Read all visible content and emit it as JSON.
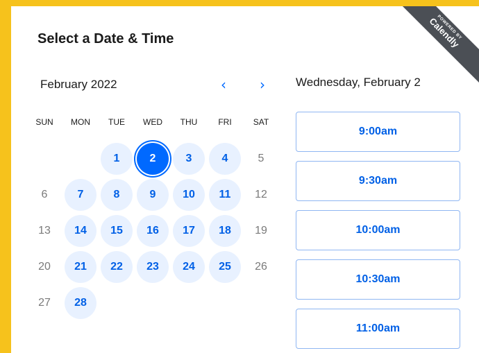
{
  "title": "Select a Date & Time",
  "powered_by": {
    "line1": "POWERED BY",
    "brand": "Calendly"
  },
  "calendar": {
    "month": "February 2022",
    "prev": "‹",
    "next": "›",
    "weekdays": [
      "SUN",
      "MON",
      "TUE",
      "WED",
      "THU",
      "FRI",
      "SAT"
    ],
    "days": [
      {
        "label": "",
        "state": "empty"
      },
      {
        "label": "",
        "state": "empty"
      },
      {
        "label": "1",
        "state": "available"
      },
      {
        "label": "2",
        "state": "selected"
      },
      {
        "label": "3",
        "state": "available"
      },
      {
        "label": "4",
        "state": "available"
      },
      {
        "label": "5",
        "state": "unavailable"
      },
      {
        "label": "6",
        "state": "unavailable"
      },
      {
        "label": "7",
        "state": "available"
      },
      {
        "label": "8",
        "state": "available"
      },
      {
        "label": "9",
        "state": "available"
      },
      {
        "label": "10",
        "state": "available"
      },
      {
        "label": "11",
        "state": "available"
      },
      {
        "label": "12",
        "state": "unavailable"
      },
      {
        "label": "13",
        "state": "unavailable"
      },
      {
        "label": "14",
        "state": "available"
      },
      {
        "label": "15",
        "state": "available"
      },
      {
        "label": "16",
        "state": "available"
      },
      {
        "label": "17",
        "state": "available"
      },
      {
        "label": "18",
        "state": "available"
      },
      {
        "label": "19",
        "state": "unavailable"
      },
      {
        "label": "20",
        "state": "unavailable"
      },
      {
        "label": "21",
        "state": "available"
      },
      {
        "label": "22",
        "state": "available"
      },
      {
        "label": "23",
        "state": "available"
      },
      {
        "label": "24",
        "state": "available"
      },
      {
        "label": "25",
        "state": "available"
      },
      {
        "label": "26",
        "state": "unavailable"
      },
      {
        "label": "27",
        "state": "unavailable"
      },
      {
        "label": "28",
        "state": "available"
      }
    ]
  },
  "selected_date": "Wednesday, February 2",
  "time_slots": [
    "9:00am",
    "9:30am",
    "10:00am",
    "10:30am",
    "11:00am"
  ],
  "colors": {
    "accent": "#0069ff",
    "background": "#f6c21c",
    "available_fill": "#e8f1ff"
  }
}
